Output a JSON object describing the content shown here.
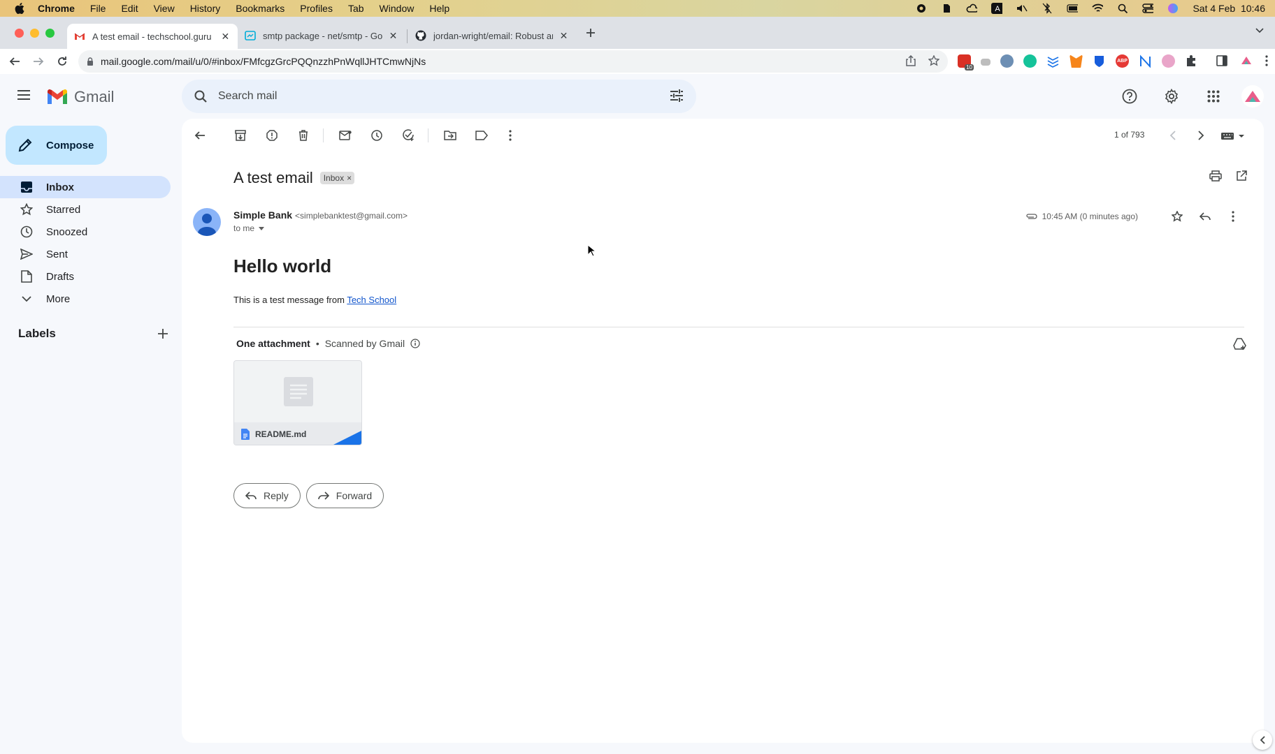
{
  "menubar": {
    "app": "Chrome",
    "items": [
      "File",
      "Edit",
      "View",
      "History",
      "Bookmarks",
      "Profiles",
      "Tab",
      "Window",
      "Help"
    ],
    "clock": "Sat 4 Feb  10:46"
  },
  "tabs": [
    {
      "title": "A test email - techschool.guru",
      "active": true
    },
    {
      "title": "smtp package - net/smtp - Go",
      "active": false
    },
    {
      "title": "jordan-wright/email: Robust an",
      "active": false
    }
  ],
  "omnibox": {
    "url": "mail.google.com/mail/u/0/#inbox/FMfcgzGrcPQQnzzhPnWqllJHTCmwNjNs"
  },
  "extensions": {
    "badge": "10"
  },
  "gmail": {
    "logo_text": "Gmail",
    "search_placeholder": "Search mail",
    "compose_label": "Compose",
    "nav": [
      {
        "label": "Inbox",
        "icon": "inbox-icon"
      },
      {
        "label": "Starred",
        "icon": "star-icon"
      },
      {
        "label": "Snoozed",
        "icon": "clock-icon"
      },
      {
        "label": "Sent",
        "icon": "send-icon"
      },
      {
        "label": "Drafts",
        "icon": "draft-icon"
      },
      {
        "label": "More",
        "icon": "chevron-down-icon"
      }
    ],
    "labels_heading": "Labels",
    "pager": "1 of 793",
    "email": {
      "subject": "A test email",
      "label_chip": "Inbox",
      "sender_name": "Simple Bank",
      "sender_email": "<simplebanktest@gmail.com>",
      "to": "to me",
      "time": "10:45 AM (0 minutes ago)",
      "heading": "Hello world",
      "body_text": "This is a test message from ",
      "body_link": "Tech School",
      "attachment_heading": "One attachment",
      "scanned": "Scanned by Gmail",
      "attachment_name": "README.md",
      "reply_label": "Reply",
      "forward_label": "Forward"
    }
  },
  "colors": {
    "accent": "#0b57d0",
    "compose_bg": "#c2e7ff",
    "active_nav": "#d3e3fd",
    "link": "#1155cc"
  }
}
